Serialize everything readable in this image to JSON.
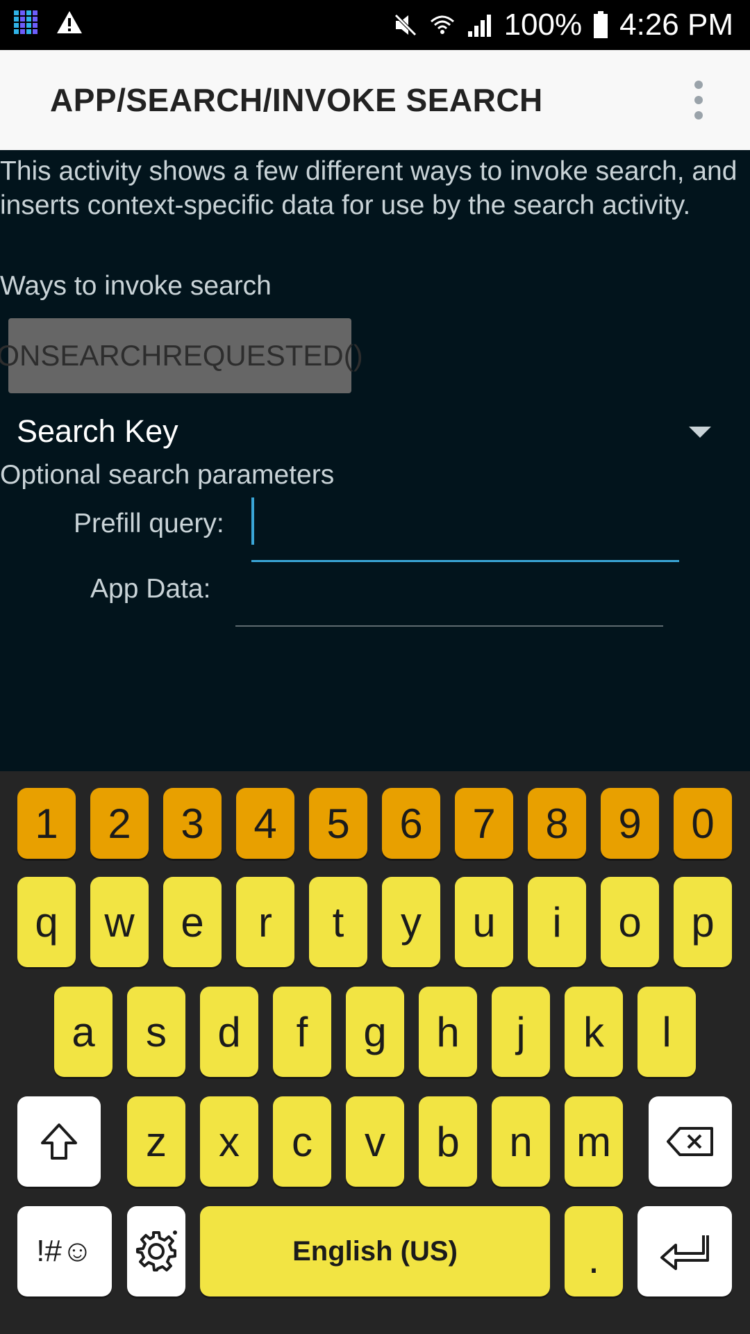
{
  "status_bar": {
    "battery": "100%",
    "time": "4:26 PM"
  },
  "action_bar": {
    "title": "APP/SEARCH/INVOKE SEARCH"
  },
  "content": {
    "description": "This activity shows a few different ways to invoke search, and inserts context-specific data for use by the search activity.",
    "ways_label": "Ways to invoke search",
    "button_label": "ONSEARCHREQUESTED()",
    "spinner_value": "Search Key",
    "optional_label": "Optional search parameters",
    "prefill_label": "Prefill query:",
    "prefill_value": "",
    "app_data_label": "App Data:",
    "app_data_value": ""
  },
  "keyboard": {
    "number_row": [
      "1",
      "2",
      "3",
      "4",
      "5",
      "6",
      "7",
      "8",
      "9",
      "0"
    ],
    "row1": [
      "q",
      "w",
      "e",
      "r",
      "t",
      "y",
      "u",
      "i",
      "o",
      "p"
    ],
    "row2": [
      "a",
      "s",
      "d",
      "f",
      "g",
      "h",
      "j",
      "k",
      "l"
    ],
    "row3": [
      "z",
      "x",
      "c",
      "v",
      "b",
      "n",
      "m"
    ],
    "symbols_label": "!#☺",
    "space_label": "English (US)",
    "period_label": "."
  }
}
